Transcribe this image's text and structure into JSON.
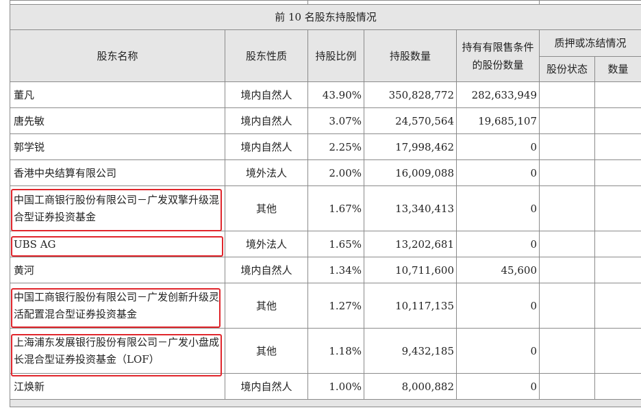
{
  "table": {
    "title": "前 10 名股东持股情况",
    "headers": {
      "name": "股东名称",
      "nature": "股东性质",
      "ratio": "持股比例",
      "shares": "持股数量",
      "restricted": "持有有限售条件的股份数量",
      "pledge_group": "质押或冻结情况",
      "pledge_status": "股份状态",
      "pledge_count": "数量"
    },
    "rows": [
      {
        "name": "董凡",
        "nature": "境内自然人",
        "ratio": "43.90%",
        "shares": "350,828,772",
        "restricted": "282,633,949"
      },
      {
        "name": "唐先敏",
        "nature": "境内自然人",
        "ratio": "3.07%",
        "shares": "24,570,564",
        "restricted": "19,685,107"
      },
      {
        "name": "郭学锐",
        "nature": "境内自然人",
        "ratio": "2.25%",
        "shares": "17,998,462",
        "restricted": "0"
      },
      {
        "name": "香港中央结算有限公司",
        "nature": "境外法人",
        "ratio": "2.00%",
        "shares": "16,009,088",
        "restricted": "0"
      },
      {
        "name": "中国工商银行股份有限公司－广发双擎升级混合型证券投资基金",
        "nature": "其他",
        "ratio": "1.67%",
        "shares": "13,340,413",
        "restricted": "0"
      },
      {
        "name": "UBS AG",
        "nature": "境外法人",
        "ratio": "1.65%",
        "shares": "13,202,681",
        "restricted": "0"
      },
      {
        "name": "黄河",
        "nature": "境内自然人",
        "ratio": "1.34%",
        "shares": "10,711,600",
        "restricted": "45,600"
      },
      {
        "name": "中国工商银行股份有限公司－广发创新升级灵活配置混合型证券投资基金",
        "nature": "其他",
        "ratio": "1.27%",
        "shares": "10,117,135",
        "restricted": "0"
      },
      {
        "name": "上海浦东发展银行股份有限公司－广发小盘成长混合型证券投资基金（LOF）",
        "nature": "其他",
        "ratio": "1.18%",
        "shares": "9,432,185",
        "restricted": "0"
      },
      {
        "name": "江焕新",
        "nature": "境内自然人",
        "ratio": "1.00%",
        "shares": "8,000,882",
        "restricted": "0"
      }
    ]
  },
  "highlight_color": "#e0242a"
}
